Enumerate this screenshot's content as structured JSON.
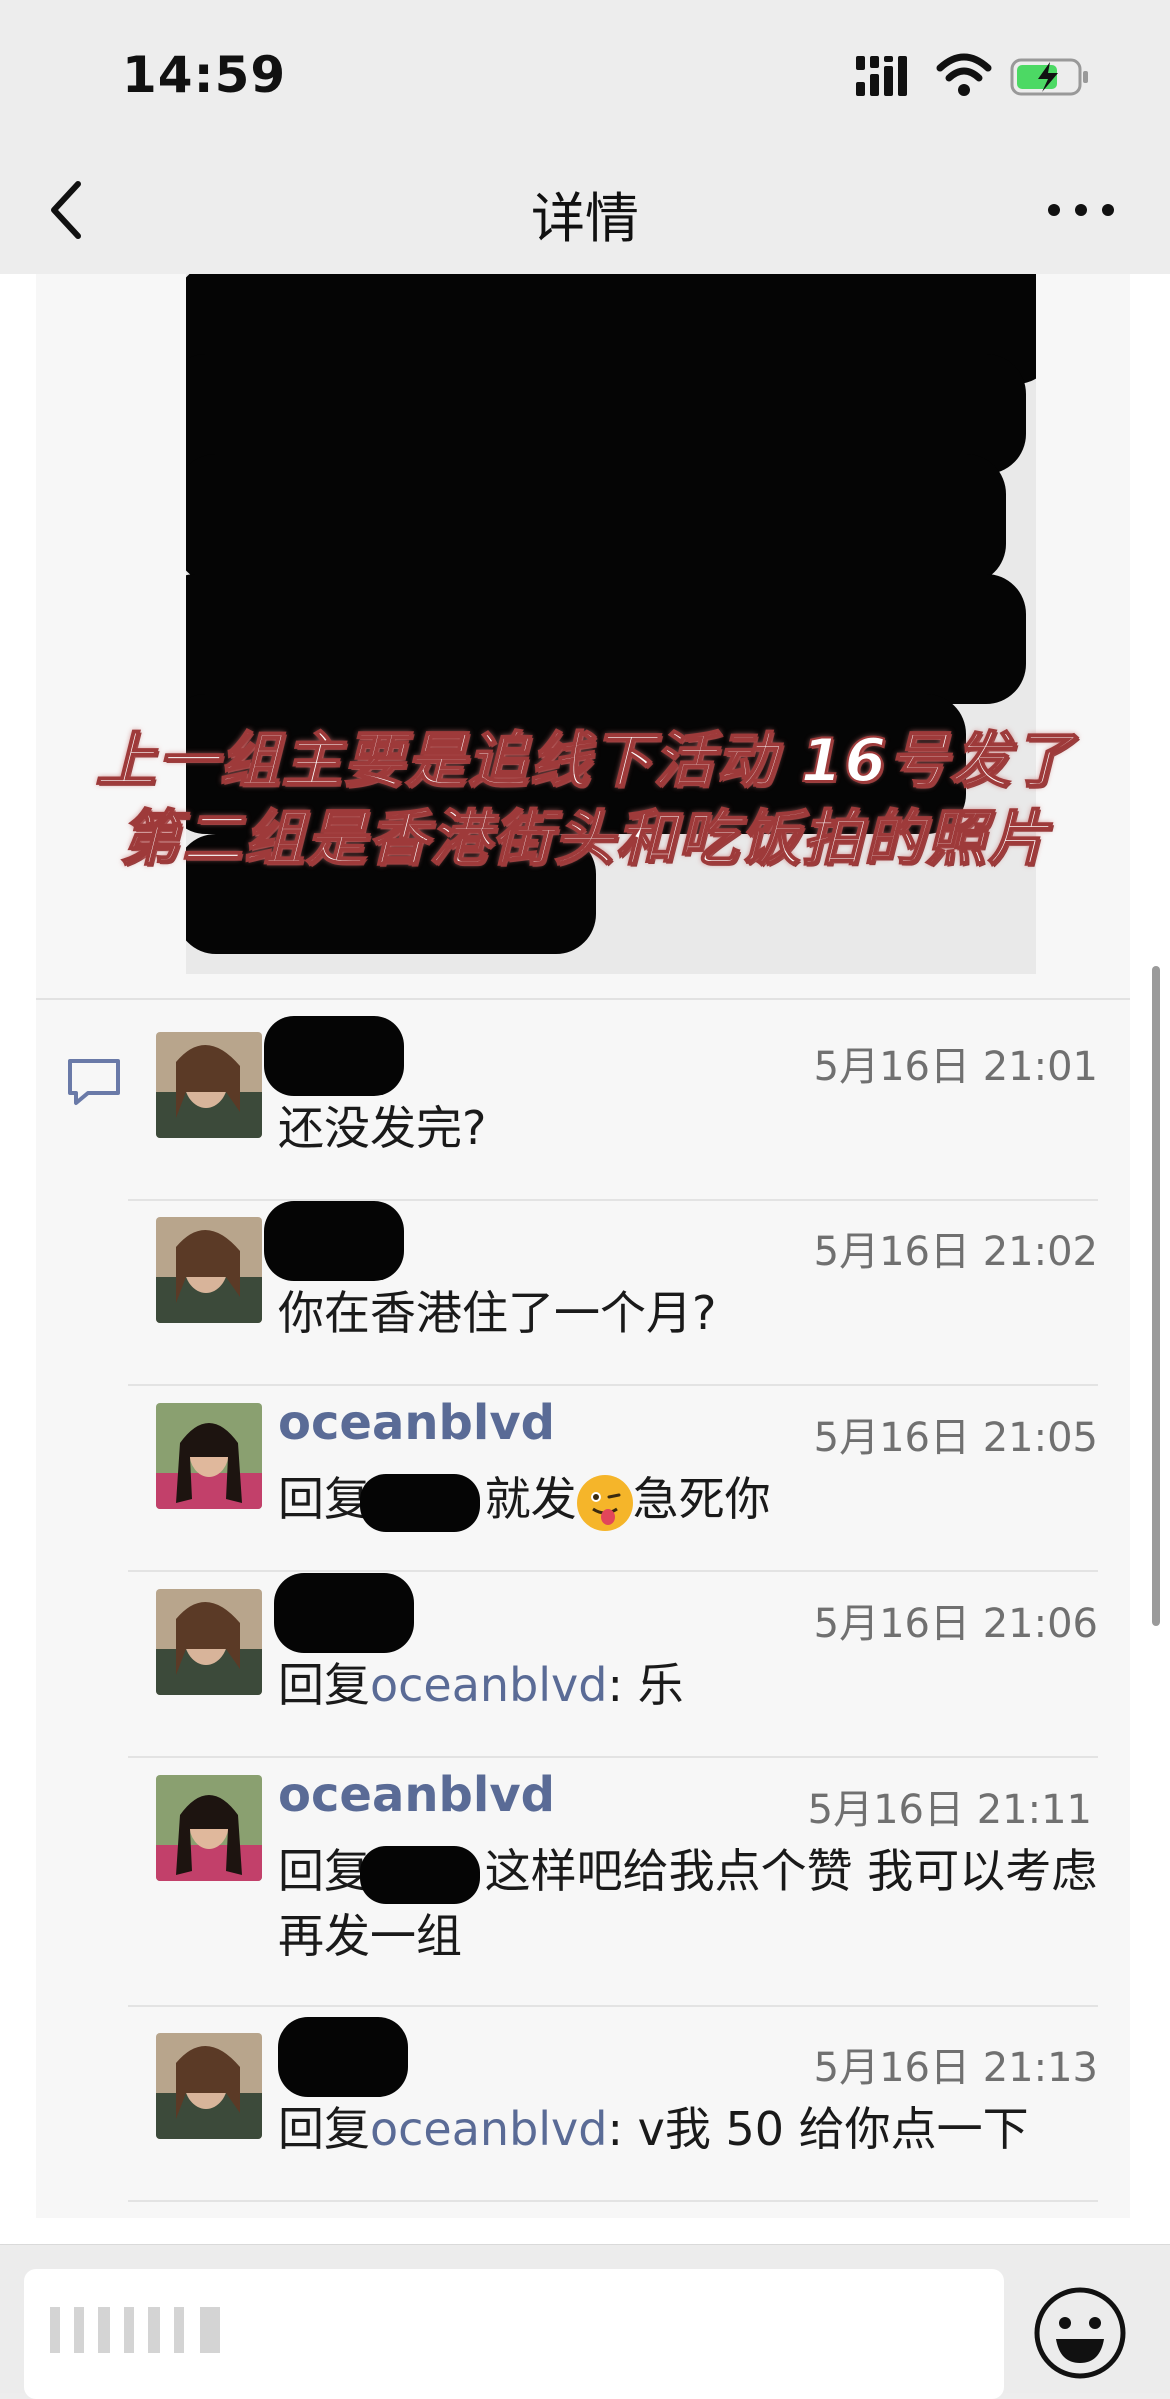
{
  "status_bar": {
    "time": "14:59"
  },
  "nav": {
    "title": "详情"
  },
  "post": {
    "overlay_line1": "上一组主要是追线下活动 16号发了",
    "overlay_line2": "第二组是香港街头和吃饭拍的照片"
  },
  "comments": [
    {
      "name": "",
      "time": "5月16日 21:01",
      "text": "还没发完?",
      "avatar": "avatar-woman-a"
    },
    {
      "name": "",
      "time": "5月16日 21:02",
      "text": "你在香港住了一个月?",
      "avatar": "avatar-woman-a"
    },
    {
      "name": "oceanblvd",
      "time": "5月16日 21:05",
      "reply_prefix": "回复",
      "reply_suffix": " 就发",
      "reply_end": "急死你",
      "emoji": "winking-tongue-emoji",
      "avatar": "avatar-woman-b"
    },
    {
      "name": "",
      "time": "5月16日 21:06",
      "reply_prefix": "回复",
      "reply_target": "oceanblvd",
      "reply_text": ": 乐",
      "avatar": "avatar-woman-a"
    },
    {
      "name": "oceanblvd",
      "time": "5月16日 21:11",
      "reply_prefix": "回复",
      "reply_text": " 这样吧给我点个赞 我可以考虑再发一组",
      "avatar": "avatar-woman-b"
    },
    {
      "name": "",
      "time": "5月16日 21:13",
      "reply_prefix": "回复",
      "reply_target": "oceanblvd",
      "reply_text": ": v我 50 给你点一下",
      "avatar": "avatar-woman-a"
    }
  ],
  "input": {
    "placeholder": ""
  },
  "icons": {
    "back": "chevron-left-icon",
    "more": "more-dots-icon",
    "comment": "comment-bubble-icon",
    "emoji": "smiley-icon"
  },
  "colors": {
    "link": "#5a6b96",
    "battery": "#4cd964"
  }
}
